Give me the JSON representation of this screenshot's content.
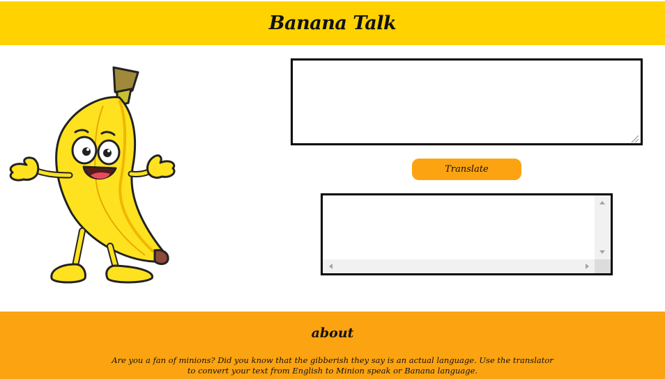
{
  "header": {
    "title": "Banana Talk"
  },
  "hero": {
    "image_label": "Banana cartoon character",
    "image_icon": "banana-character"
  },
  "translator": {
    "input_value": "",
    "button_label": "Translate",
    "output_value": ""
  },
  "about": {
    "title": "about",
    "text": "Are you a fan of minions? Did you know that the gibberish they say is an actual language. Use the translator to convert your text from English to Minion speak or Banana language."
  },
  "colors": {
    "header_bg": "#ffd200",
    "accent": "#fca311",
    "banana_yellow": "#ffe21f",
    "outline": "#000000"
  }
}
